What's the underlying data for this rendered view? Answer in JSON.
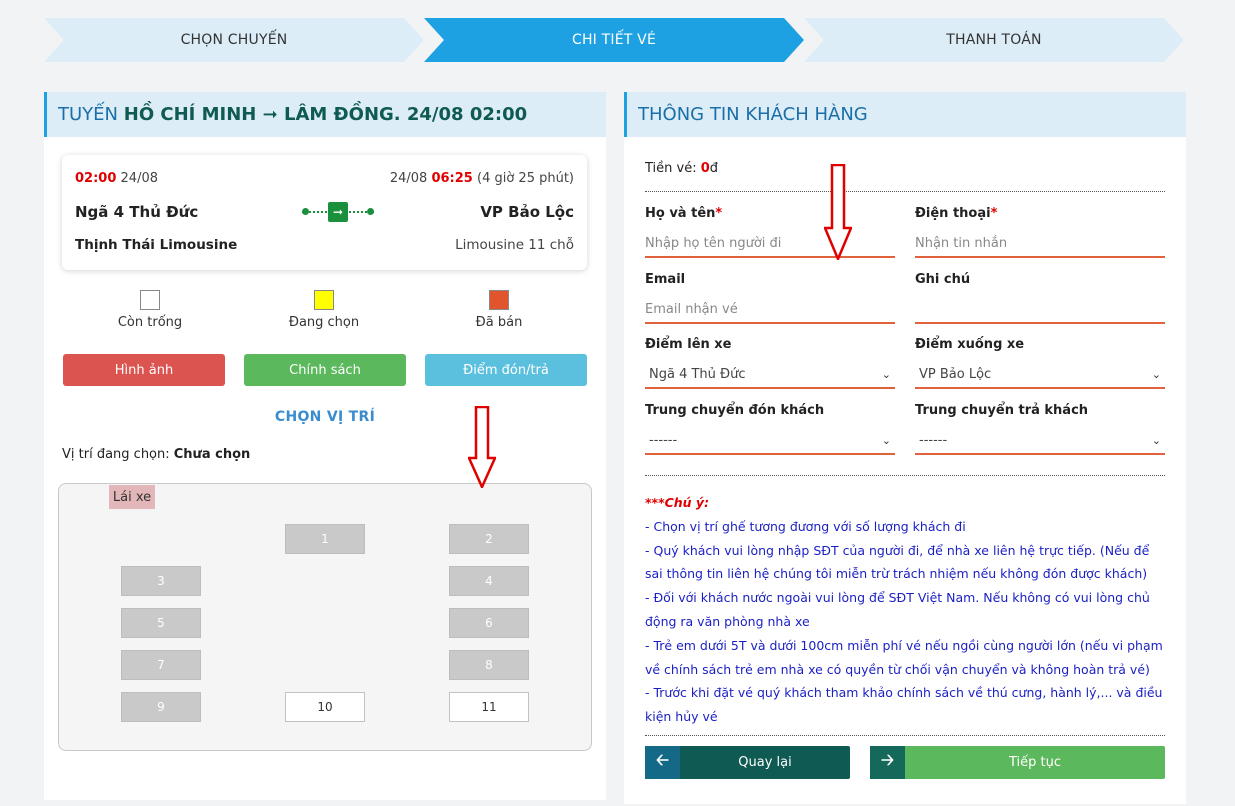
{
  "steps": [
    "CHỌN CHUYẾN",
    "CHI TIẾT VÉ",
    "THANH TOÁN"
  ],
  "left": {
    "header_prefix": "TUYẾN ",
    "header_route": "HỒ CHÍ MINH ➞ LÂM ĐỒNG",
    "header_date": ". 24/08 02:00",
    "trip": {
      "depart_time": "02:00",
      "depart_date": "24/08",
      "arrive_date": "24/08",
      "arrive_time": "06:25",
      "duration": "(4 giờ 25 phút)",
      "from": "Ngã 4 Thủ Đức",
      "to": "VP Bảo Lộc",
      "operator": "Thịnh Thái Limousine",
      "vehicle": "Limousine 11 chỗ"
    },
    "legend": [
      {
        "label": "Còn trống",
        "color": "#ffffff"
      },
      {
        "label": "Đang chọn",
        "color": "#ffff00"
      },
      {
        "label": "Đã bán",
        "color": "#e2542b"
      }
    ],
    "buttons": [
      {
        "label": "Hình ảnh",
        "color": "#dc5450"
      },
      {
        "label": "Chính sách",
        "color": "#5cb85c"
      },
      {
        "label": "Điểm đón/trả",
        "color": "#5bc0de"
      }
    ],
    "choose_title": "CHỌN VỊ TRÍ",
    "current_label": "Vị trí đang chọn: ",
    "current_value": "Chưa chọn",
    "driver": "Lái xe",
    "seats": [
      "1",
      "2",
      "3",
      "4",
      "5",
      "6",
      "7",
      "8",
      "9",
      "10",
      "11"
    ]
  },
  "right": {
    "header": "THÔNG TIN KHÁCH HÀNG",
    "price_label": "Tiền vé: ",
    "price_value": "0",
    "price_unit": "đ",
    "name_label": "Họ và tên",
    "name_placeholder": "Nhập họ tên người đi",
    "phone_label": "Điện thoại",
    "phone_placeholder": "Nhận tin nhắn",
    "email_label": "Email",
    "email_placeholder": "Email nhận vé",
    "note_label": "Ghi chú",
    "note_placeholder": "",
    "pickup_label": "Điểm lên xe",
    "pickup_value": "Ngã 4 Thủ Đức",
    "dropoff_label": "Điểm xuống xe",
    "dropoff_value": "VP Bảo Lộc",
    "transfer_pick_label": "Trung chuyển đón khách",
    "transfer_pick_value": "------",
    "transfer_drop_label": "Trung chuyển trả khách",
    "transfer_drop_value": "------",
    "notes_title": "***Chú ý:",
    "notes": [
      "- Chọn vị trí ghế tương đương với số lượng khách đi",
      "- Quý khách vui lòng nhập SĐT của người đi, để nhà xe liên hệ trực tiếp. (Nếu để sai thông tin liên hệ chúng tôi miễn trừ trách nhiệm nếu không đón được khách)",
      "- Đối với khách nước ngoài vui lòng để SĐT Việt Nam. Nếu không có vui lòng chủ động ra văn phòng nhà xe",
      "- Trẻ em dưới 5T và dưới 100cm miễn phí vé nếu ngồi cùng người lớn (nếu vi phạm về chính sách trẻ em nhà xe có quyền từ chối vận chuyển và không hoàn trả vé)",
      "- Trước khi đặt vé quý khách tham khảo chính sách về thú cưng, hành lý,... và điều kiện hủy vé"
    ],
    "back_label": "Quay lại",
    "next_label": "Tiếp tục"
  }
}
